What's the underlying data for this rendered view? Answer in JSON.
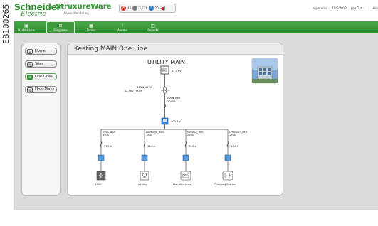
{
  "side_code": "EB100265",
  "header": {
    "brand": "Schneider",
    "brand_sub": "Electric",
    "product": "StruxureWare",
    "product_sub": "Power Monitoring",
    "alarms": {
      "red": "48",
      "grey": "3,631",
      "blue": "20"
    },
    "user": "supervisor",
    "date": "10/6/2012",
    "logout": "Log Out",
    "help": "Help"
  },
  "nav": [
    {
      "label": "Dashboards",
      "icon": "dashboard-icon"
    },
    {
      "label": "Diagrams",
      "icon": "diagram-icon"
    },
    {
      "label": "Tables",
      "icon": "table-icon"
    },
    {
      "label": "Alarms",
      "icon": "alarm-icon"
    },
    {
      "label": "Reports",
      "icon": "report-icon"
    }
  ],
  "menu": [
    {
      "label": "Home",
      "icon": "home-icon"
    },
    {
      "label": "Sites",
      "icon": "sites-icon"
    },
    {
      "label": "One Lines",
      "icon": "one-lines-icon"
    },
    {
      "label": "Floor Plans",
      "icon": "floor-plans-icon"
    }
  ],
  "main": {
    "title": "Keating MAIN One Line",
    "utility_label": "UTILITY MAIN",
    "utility_kv": "12.5 kV",
    "xfmr_label": "MAIN_XFMR",
    "xfmr_rating": "12.5kV - 600V",
    "bkr_label": "MAIN_BKR",
    "bkr_rating": "1000A",
    "bus_voltage": "300.0 V",
    "branches": [
      {
        "bkr": "HVAC_BKR",
        "rating": "500A",
        "current": "37.5 A",
        "load": "HVAC",
        "icon": "fan-icon"
      },
      {
        "bkr": "LIGHTING_BKR",
        "rating": "150A",
        "current": "38.6 A",
        "load": "Lighting",
        "icon": "lightbulb-icon"
      },
      {
        "bkr": "MANFCT_BKR",
        "rating": "250A",
        "current": "75.3 A",
        "load": "Manufacturing",
        "icon": "manufacturing-icon"
      },
      {
        "bkr": "CHARGST_BKR",
        "rating": "120A",
        "current": "3.58 A",
        "load": "Charging Station",
        "icon": "charging-station-icon"
      }
    ]
  },
  "colors": {
    "brand_green": "#2d8a2d",
    "nav_green": "#3c9a3c",
    "meter_blue": "#3a7fd0"
  }
}
